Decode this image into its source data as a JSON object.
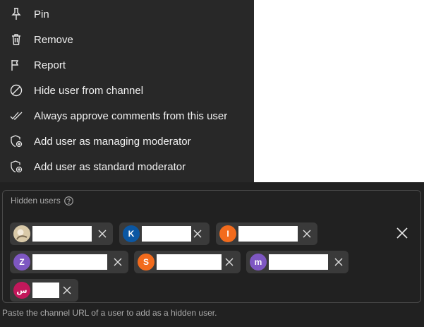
{
  "menu": {
    "items": [
      {
        "label": "Pin",
        "icon": "pin-icon"
      },
      {
        "label": "Remove",
        "icon": "trash-icon"
      },
      {
        "label": "Report",
        "icon": "flag-icon"
      },
      {
        "label": "Hide user from channel",
        "icon": "block-icon"
      },
      {
        "label": "Always approve comments from this user",
        "icon": "double-check-icon"
      },
      {
        "label": "Add user as managing moderator",
        "icon": "shield-add-icon"
      },
      {
        "label": "Add user as standard moderator",
        "icon": "shield-add-icon"
      }
    ]
  },
  "hidden_users": {
    "title": "Hidden users",
    "users": [
      {
        "initial": "",
        "avatar_color": "#d9c9a8"
      },
      {
        "initial": "K",
        "avatar_color": "#0b57a3"
      },
      {
        "initial": "I",
        "avatar_color": "#f26b1d"
      },
      {
        "initial": "Z",
        "avatar_color": "#7e57c2"
      },
      {
        "initial": "S",
        "avatar_color": "#f26b1d"
      },
      {
        "initial": "m",
        "avatar_color": "#7e57c2"
      },
      {
        "initial": "س",
        "avatar_color": "#c2185b"
      }
    ],
    "hint": "Paste the channel URL of a user to add as a hidden user."
  },
  "colors": {
    "menu_bg": "#282828",
    "panel_bg": "#212121",
    "chip_bg": "#3a3a3a",
    "text": "#f1f1f1",
    "muted_text": "#aaaaaa"
  }
}
